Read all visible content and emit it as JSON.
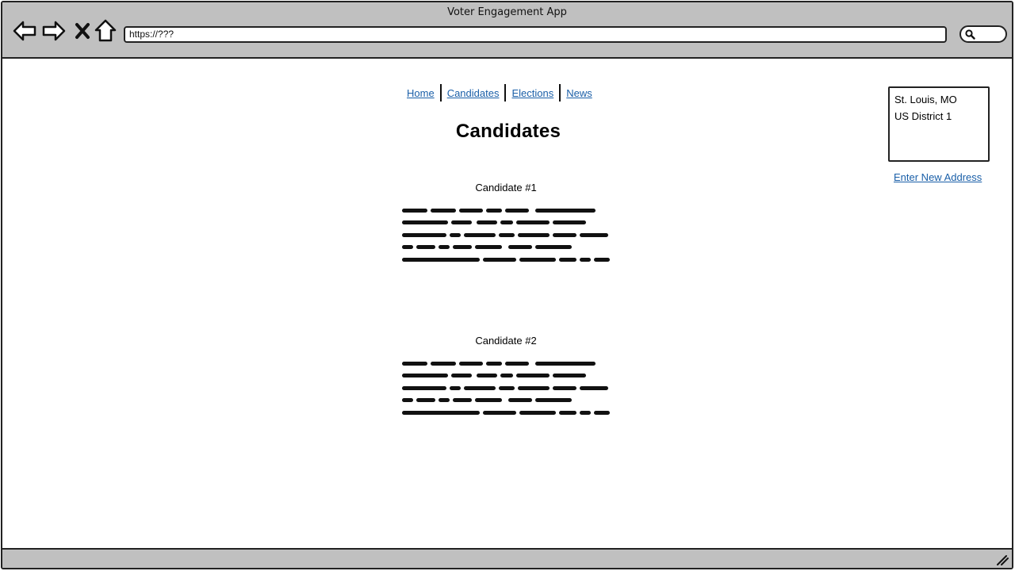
{
  "window": {
    "title": "Voter Engagement App"
  },
  "toolbar": {
    "back_icon": "arrow-left-icon",
    "forward_icon": "arrow-right-icon",
    "stop_icon": "close-icon",
    "home_icon": "home-icon",
    "url": "https://???",
    "search_icon": "search-icon"
  },
  "nav": {
    "items": [
      {
        "label": "Home"
      },
      {
        "label": "Candidates"
      },
      {
        "label": "Elections"
      },
      {
        "label": "News"
      }
    ]
  },
  "page": {
    "title": "Candidates"
  },
  "candidates": [
    {
      "name": "Candidate #1"
    },
    {
      "name": "Candidate #2"
    }
  ],
  "location": {
    "city": "St. Louis, MO",
    "district": "US District 1",
    "change_label": "Enter New Address"
  },
  "colors": {
    "link": "#1a5fa8",
    "chrome": "#c0c0c0",
    "border": "#222222"
  }
}
